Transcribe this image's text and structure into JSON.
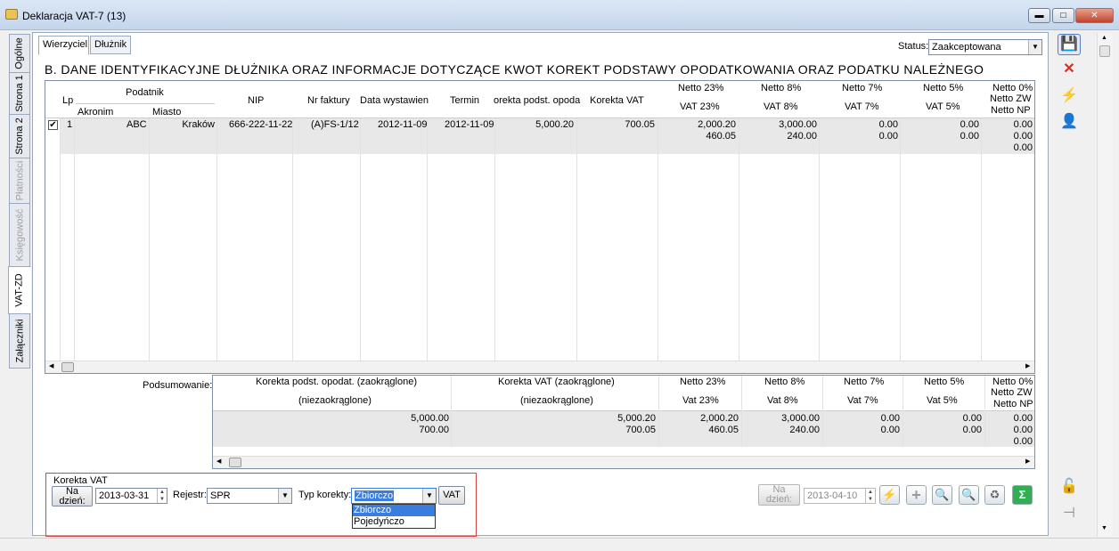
{
  "window": {
    "title": "Deklaracja VAT-7 (13)"
  },
  "vertical_tabs": [
    {
      "label": "Ogólne",
      "disabled": false
    },
    {
      "label": "Strona 1",
      "disabled": false
    },
    {
      "label": "Strona 2",
      "disabled": false
    },
    {
      "label": "Płatności",
      "disabled": true
    },
    {
      "label": "Księgowość",
      "disabled": true
    },
    {
      "label": "VAT-ZD",
      "disabled": false,
      "active": true
    },
    {
      "label": "Załączniki",
      "disabled": false
    }
  ],
  "tabs": {
    "creditor": "Wierzyciel",
    "debtor": "Dłużnik"
  },
  "status": {
    "label": "Status:",
    "value": "Zaakceptowana"
  },
  "section_title": "B. DANE IDENTYFIKACYJNE DŁUŻNIKA ORAZ INFORMACJE DOTYCZĄCE KWOT KOREKT PODSTAWY OPODATKOWANIA ORAZ PODATKU NALEŻNEGO",
  "grid": {
    "headers": {
      "lp": "Lp",
      "podatnik": "Podatnik",
      "akronim": "Akronim",
      "miasto": "Miasto",
      "nip": "NIP",
      "nr_faktury": "Nr faktury",
      "data_wystawienia": "Data wystawien",
      "termin": "Termin",
      "korekta_podst": "orekta podst. opoda",
      "korekta_vat": "Korekta VAT",
      "netto23": "Netto 23%",
      "vat23": "VAT 23%",
      "netto8": "Netto 8%",
      "vat8": "VAT 8%",
      "netto7": "Netto 7%",
      "vat7": "VAT 7%",
      "netto5": "Netto 5%",
      "vat5": "VAT 5%",
      "netto0": "Netto 0%",
      "nettozw": "Netto ZW",
      "nettonp": "Netto NP"
    },
    "row": {
      "checked": true,
      "check_mark": "✔",
      "lp": "1",
      "akronim": "ABC",
      "miasto": "Kraków",
      "nip": "666-222-11-22",
      "nr_faktury": "(A)FS-1/12",
      "data_wystawienia": "2012-11-09",
      "termin": "2012-11-09",
      "korekta_podst": "5,000.20",
      "korekta_vat": "700.05",
      "netto23": "2,000.20",
      "vat23": "460.05",
      "netto8": "3,000.00",
      "vat8": "240.00",
      "netto7": "0.00",
      "vat7": "0.00",
      "netto5": "0.00",
      "vat5": "0.00",
      "netto0": "0.00",
      "nettozw": "0.00",
      "nettonp": "0.00"
    }
  },
  "summary": {
    "label": "Podsumowanie:",
    "headers": {
      "korekta_podst": "Korekta podst. opodat. (zaokrąglone)",
      "korekta_podst_sub": "(niezaokrąglone)",
      "korekta_vat": "Korekta VAT (zaokrąglone)",
      "korekta_vat_sub": "(niezaokrąglone)",
      "netto23": "Netto 23%",
      "vat23": "Vat 23%",
      "netto8": "Netto 8%",
      "vat8": "Vat 8%",
      "netto7": "Netto 7%",
      "vat7": "Vat 7%",
      "netto5": "Netto 5%",
      "vat5": "Vat 5%",
      "netto0": "Netto 0%",
      "nettozw": "Netto ZW",
      "nettonp": "Netto NP"
    },
    "values": {
      "korekta_podst": "5,000.00",
      "korekta_podst_sub": "700.00",
      "korekta_vat": "5,000.20",
      "korekta_vat_sub": "700.05",
      "netto23": "2,000.20",
      "vat23": "460.05",
      "netto8": "3,000.00",
      "vat8": "240.00",
      "netto7": "0.00",
      "vat7": "0.00",
      "netto5": "0.00",
      "vat5": "0.00",
      "netto0": "0.00",
      "nettozw": "0.00",
      "nettonp": "0.00"
    }
  },
  "korekta_vat": {
    "group_label": "Korekta VAT",
    "na_dzien_label": "Na dzień:",
    "date": "2013-03-31",
    "rejestr_label": "Rejestr:",
    "rejestr_value": "SPR",
    "typ_label": "Typ korekty:",
    "typ_value": "Zbiorczo",
    "vat_button": "VAT",
    "dropdown_options": [
      "Zbiorczo",
      "Pojedyńczo"
    ]
  },
  "bottom_right": {
    "na_dzien_label": "Na dzień:",
    "date": "2013-04-10"
  },
  "window_buttons": {
    "minimize": "▬",
    "maximize": "□",
    "close": "✕"
  },
  "icons": {
    "save": "💾",
    "cancel": "✕",
    "lightning": "⚡",
    "user_tool": "👤",
    "lock": "🔓",
    "pin": "⊣",
    "add": "+",
    "search": "🔍",
    "search2": "🔍",
    "recycle": "♻",
    "sum": "Σ",
    "arrow_left": "◀",
    "arrow_right": "▶",
    "arrow_up": "▲",
    "arrow_down": "▼",
    "dropdown": "▼"
  },
  "colors": {
    "accent_red": "#d24848",
    "selection": "#3b7ce0"
  }
}
